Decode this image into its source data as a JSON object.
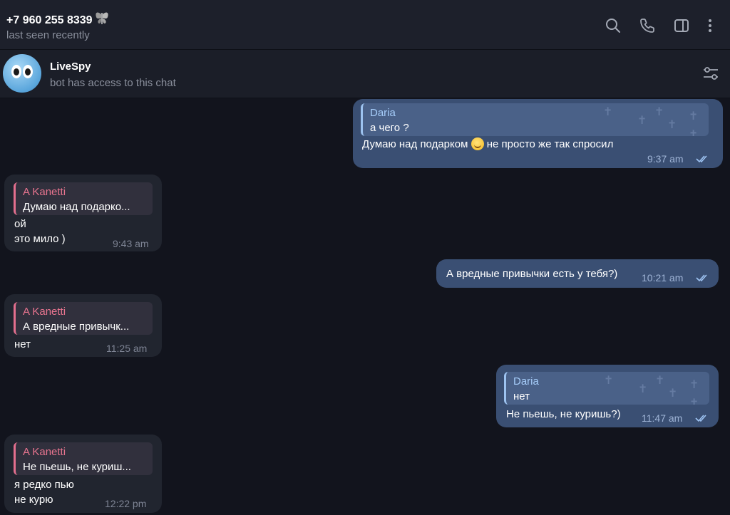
{
  "header": {
    "contact_name": "+7 960 255 8339",
    "status": "last seen recently",
    "icons": [
      "search-icon",
      "phone-icon",
      "sidebar-toggle-icon",
      "more-vertical-icon"
    ]
  },
  "bot_bar": {
    "name": "LiveSpy",
    "subtitle": "bot has access to this chat"
  },
  "messages": [
    {
      "direction": "out",
      "reply_name": "Daria",
      "reply_text": "а чего ?",
      "text_before_emoji": "Думаю над подарком",
      "emoji": "grinning-face-emoji",
      "text_after_emoji": "не просто же так спросил",
      "time": "9:37 am",
      "read": true
    },
    {
      "direction": "in",
      "reply_name": "A Kanetti",
      "reply_text": "Думаю над подарко...",
      "lines": [
        "ой",
        "это мило )"
      ],
      "time": "9:43 am"
    },
    {
      "direction": "out",
      "text": "А вредные привычки есть у тебя?)",
      "time": "10:21 am",
      "read": true
    },
    {
      "direction": "in",
      "reply_name": "A Kanetti",
      "reply_text": "А вредные привычк...",
      "lines": [
        "нет"
      ],
      "time": "11:25 am"
    },
    {
      "direction": "out",
      "reply_name": "Daria",
      "reply_text": "нет",
      "text": "Не пьешь, не куришь?)",
      "time": "11:47 am",
      "read": true
    },
    {
      "direction": "in",
      "reply_name": "A Kanetti",
      "reply_text": "Не пьешь, не куриш...",
      "lines": [
        "я редко пью",
        "не курю"
      ],
      "time": "12:22 pm"
    }
  ],
  "colors": {
    "background": "#12141d",
    "header": "#1d202b",
    "outgoing_bubble": "#3a4f73",
    "incoming_bubble": "#21252f",
    "reply_accent_out": "#9dc3f0",
    "reply_accent_in": "#e36f8e"
  }
}
